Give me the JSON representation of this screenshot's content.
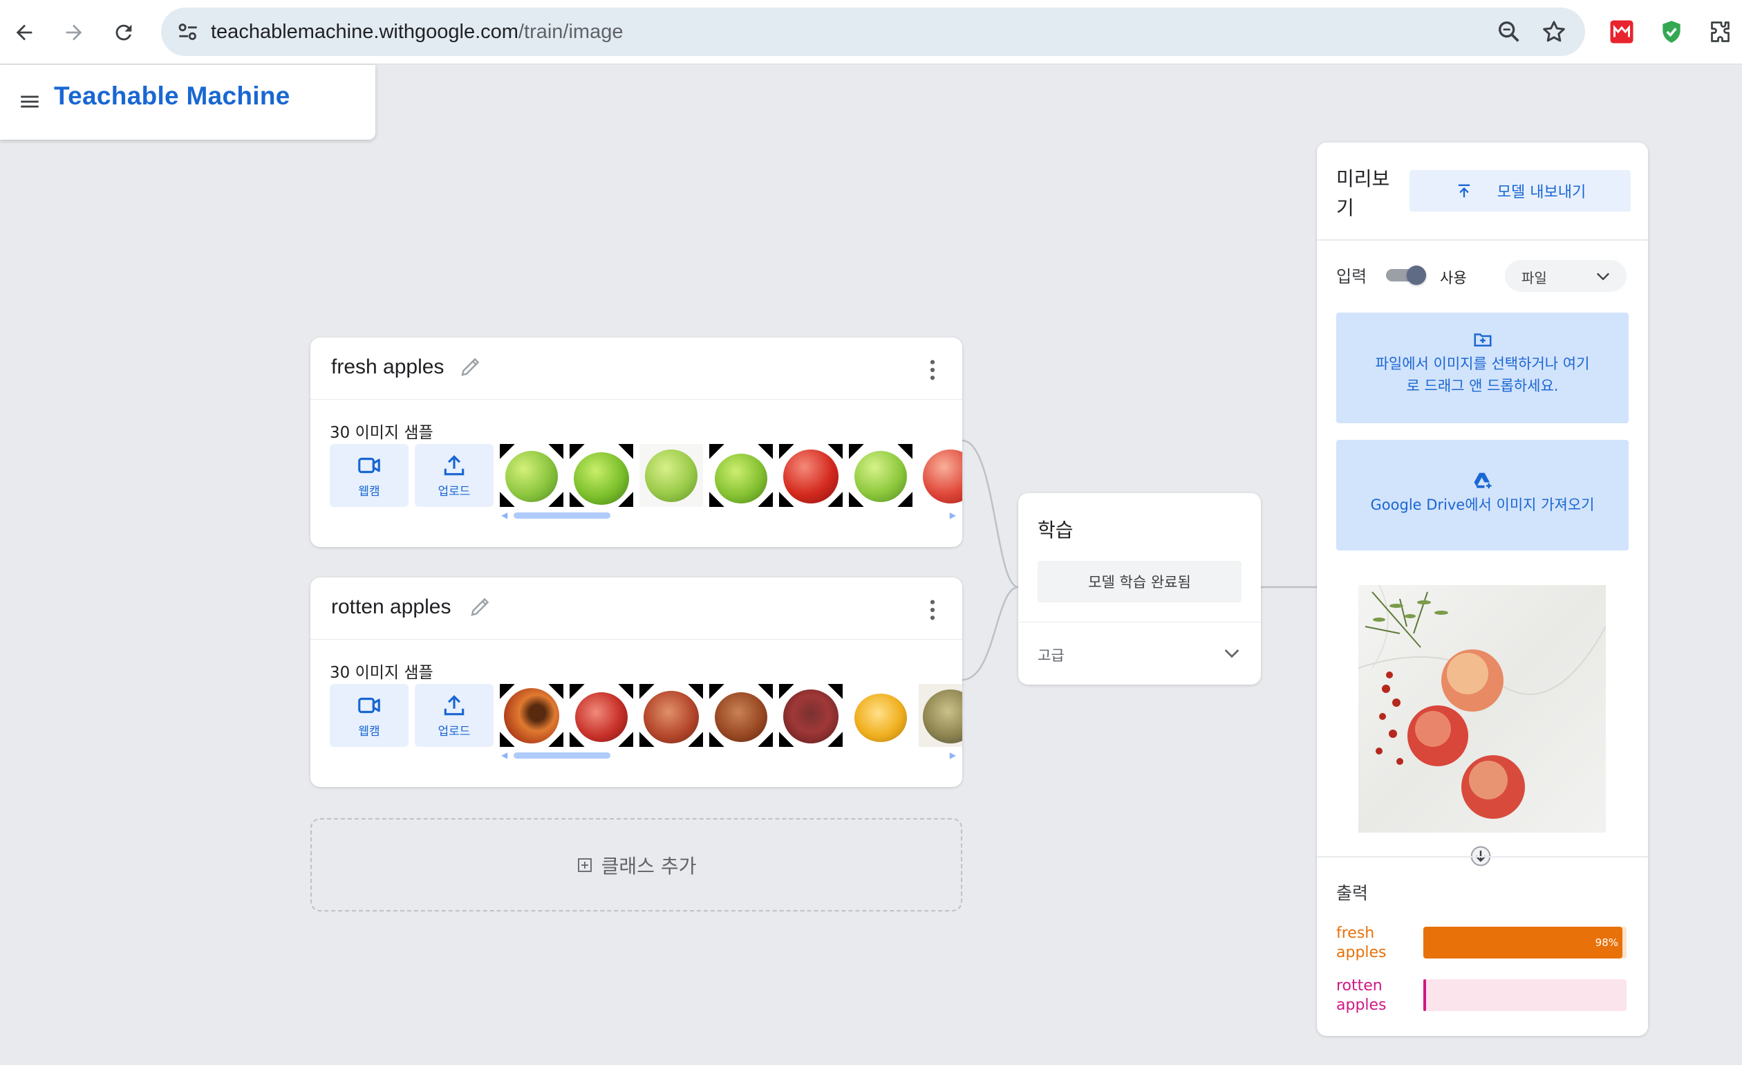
{
  "browser": {
    "url_host": "teachablemachine.withgoogle.com",
    "url_path": "/train/image"
  },
  "app": {
    "title": "Teachable Machine"
  },
  "classes": [
    {
      "name": "fresh apples",
      "samples": "30 이미지 샘플",
      "webcam_label": "웹캠",
      "upload_label": "업로드"
    },
    {
      "name": "rotten apples",
      "samples": "30 이미지 샘플",
      "webcam_label": "웹캠",
      "upload_label": "업로드"
    }
  ],
  "add_class": {
    "label": "클래스 추가"
  },
  "training": {
    "title": "학습",
    "button_label": "모델 학습 완료됨",
    "advanced_label": "고급"
  },
  "preview": {
    "title": "미리보기",
    "export_label": "모델 내보내기",
    "input_label": "입력",
    "toggle_label": "사용",
    "toggle_on": true,
    "source_select": "파일",
    "drop_text_1": "파일에서 이미지를 선택하거나 여기",
    "drop_text_2": "로 드래그 앤 드롭하세요.",
    "drive_text": "Google Drive에서 이미지 가져오기",
    "output_label": "출력",
    "outputs": [
      {
        "name_1": "fresh",
        "name_2": "apples",
        "percent": 98,
        "percent_label": "98%",
        "color": "#e8710a"
      },
      {
        "name_1": "rotten",
        "name_2": "apples",
        "percent": 1,
        "percent_label": "",
        "color": "#d01884"
      }
    ]
  },
  "colors": {
    "brand": "#1967d2",
    "card_button_bg": "#e8f0fe",
    "drop_bg": "#d2e3fc",
    "fresh_bar": "#e8710a",
    "rotten_bar": "#f7d3dc"
  }
}
